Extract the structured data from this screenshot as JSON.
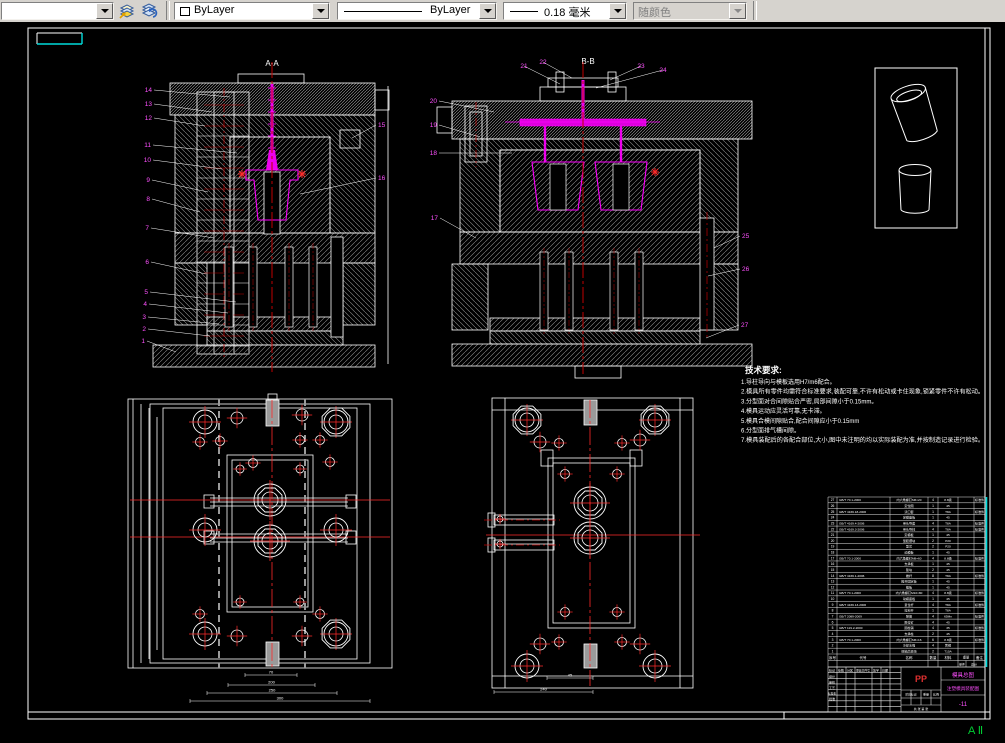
{
  "toolbar": {
    "layer_combo": {
      "value": ""
    },
    "color_combo": {
      "value": "ByLayer"
    },
    "linetype_combo": {
      "value": "ByLayer"
    },
    "lineweight_combo": {
      "value": "0.18 毫米"
    },
    "plotstyle_combo": {
      "value": "随颜色"
    }
  },
  "drawing": {
    "section_a": {
      "label": "A-A",
      "callouts_left": [
        "14",
        "13",
        "12",
        "11",
        "10",
        "9",
        "8",
        "7",
        "6",
        "5",
        "4",
        "3",
        "2",
        "1"
      ],
      "callouts_right": [
        "15",
        "16"
      ]
    },
    "section_b": {
      "label": "B-B",
      "callouts_top": [
        "21",
        "22",
        "23",
        "24"
      ],
      "callouts_left": [
        "20",
        "19",
        "18",
        "17"
      ],
      "callouts_right": [
        "25",
        "26",
        "27"
      ]
    },
    "plan_left": {
      "dims_bottom": [
        "70",
        "200",
        "250",
        "300"
      ]
    },
    "plan_right": {
      "dims_bottom": [
        "45",
        "240"
      ]
    },
    "format_label": "A Ⅱ"
  },
  "tech_requirements": {
    "title": "技术要求:",
    "lines": [
      "1.导柱导向与模板选用H7/m6配合。",
      "2.模具所有零件均需符合标准要求,装配可靠,不许有松动或卡住现象,锁紧零件不许有松动。",
      "3.分型面对合间隙贴合严密,局部间隙小于0.15mm。",
      "4.模具运动应灵活可靠,无卡滞。",
      "5.模具合模间隙贴合,配合间隙应小于0.15mm",
      "6.分型面排气槽间隙。",
      "7.模具装配后的各配合部位,大小,图中未注明的均以实际装配为准,并按制造记录进行检验。"
    ]
  },
  "bom": {
    "headers": {
      "seq": "序号",
      "code": "代号",
      "name": "名称",
      "qty": "数量",
      "material": "材料",
      "weight": "重量",
      "weight_each": "单件",
      "weight_total": "总计",
      "remark": "备注"
    },
    "rows": [
      [
        "27",
        "GB/T 70.1-2000",
        "内六角螺钉M6×20",
        "4",
        "8.8级",
        "标准件"
      ],
      [
        "26",
        "",
        "定位圈",
        "1",
        "45",
        ""
      ],
      [
        "25",
        "GB/T 4169.18-2006",
        "浇口套",
        "1",
        "T8A",
        "标准件"
      ],
      [
        "24",
        "",
        "定模座板",
        "1",
        "45",
        ""
      ],
      [
        "23",
        "GB/T 4169.4-2006",
        "带头导套",
        "4",
        "T8A",
        "标准件"
      ],
      [
        "22",
        "GB/T 4169.3-2006",
        "带头导柱",
        "4",
        "T8A",
        "标准件"
      ],
      [
        "21",
        "",
        "定模板",
        "1",
        "45",
        ""
      ],
      [
        "20",
        "",
        "型腔镶块",
        "2",
        "P20",
        ""
      ],
      [
        "19",
        "",
        "型芯",
        "2",
        "P20",
        ""
      ],
      [
        "18",
        "",
        "动模板",
        "1",
        "45",
        ""
      ],
      [
        "17",
        "GB/T 70.1-2000",
        "内六角螺钉M8×60",
        "4",
        "8.8级",
        "标准件"
      ],
      [
        "16",
        "",
        "支承板",
        "1",
        "45",
        ""
      ],
      [
        "15",
        "",
        "垫块",
        "2",
        "45",
        ""
      ],
      [
        "14",
        "GB/T 4169.1-2006",
        "推杆",
        "8",
        "T8A",
        "标准件"
      ],
      [
        "13",
        "",
        "推杆固定板",
        "1",
        "45",
        ""
      ],
      [
        "12",
        "",
        "推板",
        "1",
        "45",
        ""
      ],
      [
        "11",
        "GB/T 70.1-2000",
        "内六角螺钉M10×80",
        "4",
        "8.8级",
        "标准件"
      ],
      [
        "10",
        "",
        "动模座板",
        "1",
        "45",
        ""
      ],
      [
        "9",
        "GB/T 4169.13-2006",
        "复位杆",
        "4",
        "T8A",
        "标准件"
      ],
      [
        "8",
        "",
        "拉料杆",
        "1",
        "T8A",
        ""
      ],
      [
        "7",
        "GB/T 2089-2009",
        "弹簧",
        "4",
        "65Mn",
        "标准件"
      ],
      [
        "6",
        "",
        "限位钉",
        "4",
        "45",
        ""
      ],
      [
        "5",
        "GB/T 119.2-2000",
        "圆柱销",
        "4",
        "35",
        "标准件"
      ],
      [
        "4",
        "",
        "支承柱",
        "2",
        "45",
        ""
      ],
      [
        "3",
        "GB/T 70.1-2000",
        "内六角螺钉M6×16",
        "6",
        "8.8级",
        "标准件"
      ],
      [
        "2",
        "",
        "冷却水嘴",
        "4",
        "黄铜",
        ""
      ],
      [
        "1",
        "",
        "侧抽芯滑块",
        "2",
        "T10A",
        ""
      ]
    ]
  },
  "title_block": {
    "material": "PP",
    "labels": {
      "mark": "标记",
      "count": "处数",
      "zone": "分区",
      "doc_no": "更改文件号",
      "sign": "签字",
      "date": "日期",
      "design": "设计",
      "check": "审核",
      "process": "工艺",
      "standard": "标准化",
      "approve": "批准",
      "stage": "阶段标记",
      "weight": "重量",
      "scale": "比例",
      "sheets": "共 张 第 张"
    },
    "title_line1": "模具总图",
    "title_line2": "注塑模具装配图",
    "drawing_no": "-11"
  },
  "colors": {
    "callout_magenta": "#ff50ff",
    "sprue_magenta": "#ee00ee",
    "centerline_red": "#c00000",
    "crosshair_red": "#ff2a2a",
    "hatch_gray": "#8f8f8f",
    "cyan": "#00dcdc",
    "green": "#00cc33",
    "material_red": "#e03030"
  }
}
